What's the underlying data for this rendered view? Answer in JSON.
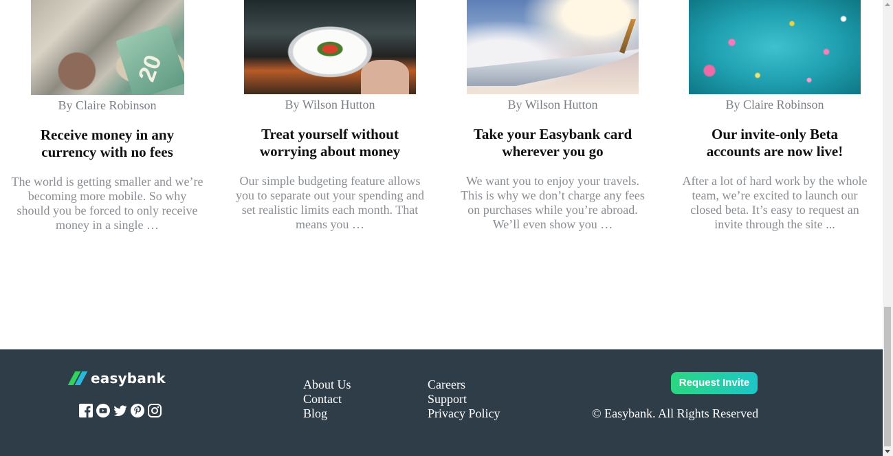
{
  "articles": [
    {
      "image_desc": "Assorted banknotes including a 20 note",
      "image_text": "20",
      "author": "By Claire Robinson",
      "title_line1": "Receive money in any",
      "title_line2": "currency with no fees",
      "excerpt_lines": [
        "The world is getting smaller and we’re",
        "becoming more mobile. So why",
        "should you be forced to only receive",
        "money in a single …"
      ]
    },
    {
      "image_desc": "Restaurant dinner plate",
      "author": "By Wilson Hutton",
      "title_line1": "Treat yourself without",
      "title_line2": "worrying about money",
      "excerpt_lines": [
        "Our simple budgeting feature allows",
        "you to separate out your spending and",
        "set realistic limits each month. That",
        "means you …"
      ]
    },
    {
      "image_desc": "Airplane wing above clouds",
      "author": "By Wilson Hutton",
      "title_line1": "Take your Easybank card",
      "title_line2": "wherever you go",
      "excerpt_lines": [
        "We want you to enjoy your travels.",
        "This is why we don’t charge any fees",
        "on purchases while you’re abroad.",
        "We’ll even show you …"
      ]
    },
    {
      "image_desc": "Confetti on teal background",
      "author": "By Claire Robinson",
      "title_line1": "Our invite-only Beta",
      "title_line2": "accounts are now live!",
      "excerpt_lines": [
        "After a lot of hard work by the whole",
        "team, we’re excited to launch our",
        "closed beta. It’s easy to request an",
        "invite through the site ..."
      ]
    }
  ],
  "footer": {
    "logo_text": "easybank",
    "socials": [
      "facebook-icon",
      "youtube-icon",
      "twitter-icon",
      "pinterest-icon",
      "instagram-icon"
    ],
    "links_col1": [
      "About Us",
      "Contact",
      "Blog"
    ],
    "links_col2": [
      "Careers",
      "Support",
      "Privacy Policy"
    ],
    "cta": "Request Invite",
    "copyright": "© Easybank. All Rights Reserved"
  },
  "colors": {
    "footer_bg": "#2e3d48",
    "cta_gradient_start": "#2ad780",
    "cta_gradient_end": "#1dc6c7",
    "title_text": "#111111",
    "muted_text": "#8a8d92"
  }
}
